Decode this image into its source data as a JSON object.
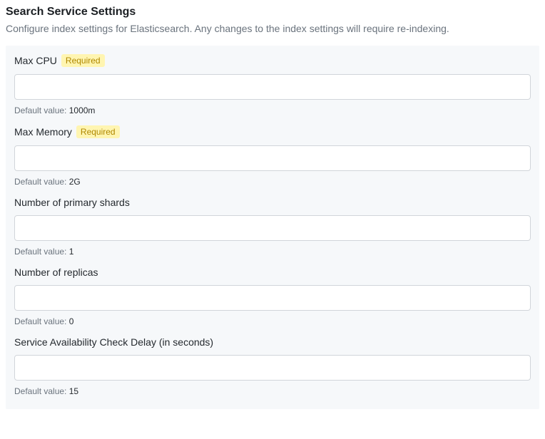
{
  "header": {
    "title": "Search Service Settings",
    "description": "Configure index settings for Elasticsearch. Any changes to the index settings will require re-indexing."
  },
  "common": {
    "required_badge": "Required",
    "default_prefix": "Default value: "
  },
  "fields": {
    "max_cpu": {
      "label": "Max CPU",
      "required": true,
      "value": "",
      "default": "1000m"
    },
    "max_memory": {
      "label": "Max Memory",
      "required": true,
      "value": "",
      "default": "2G"
    },
    "primary_shards": {
      "label": "Number of primary shards",
      "required": false,
      "value": "",
      "default": "1"
    },
    "replicas": {
      "label": "Number of replicas",
      "required": false,
      "value": "",
      "default": "0"
    },
    "availability_delay": {
      "label": "Service Availability Check Delay (in seconds)",
      "required": false,
      "value": "",
      "default": "15"
    }
  }
}
